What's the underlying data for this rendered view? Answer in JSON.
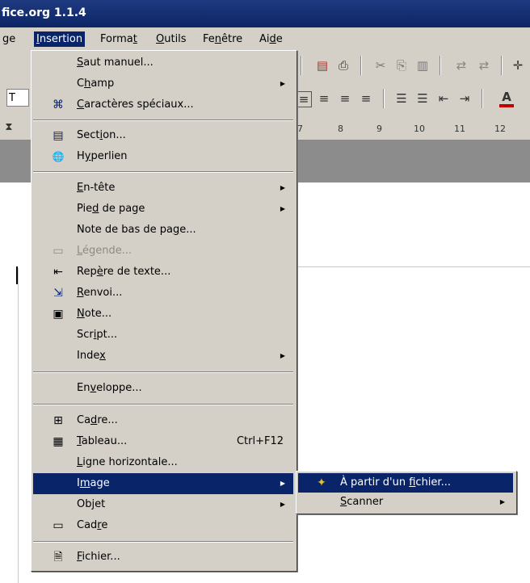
{
  "window": {
    "title_fragment": "fice.org 1.1.4"
  },
  "menubar": {
    "items": [
      {
        "label": "ge"
      },
      {
        "pre": "",
        "u": "I",
        "post": "nsertion"
      },
      {
        "pre": "Forma",
        "u": "t",
        "post": ""
      },
      {
        "pre": "",
        "u": "O",
        "post": "utils"
      },
      {
        "pre": "Fe",
        "u": "n",
        "post": "être"
      },
      {
        "pre": "Ai",
        "u": "d",
        "post": "e"
      }
    ]
  },
  "ruler": {
    "ticks": [
      "7",
      "8",
      "9",
      "10",
      "11",
      "12"
    ]
  },
  "toolbar": {
    "font_box_fragment": "T"
  },
  "insert_menu": {
    "items": [
      {
        "pre": "",
        "u": "S",
        "post": "aut manuel..."
      },
      {
        "pre": "C",
        "u": "h",
        "post": "amp",
        "arrow": "▶"
      },
      {
        "pre": "",
        "u": "C",
        "post": "aractères spéciaux...",
        "icon": "⌘"
      },
      {
        "pre": "Sect",
        "u": "i",
        "post": "on...",
        "icon": "▤"
      },
      {
        "pre": "H",
        "u": "y",
        "post": "perlien",
        "icon": "🌐"
      },
      {
        "pre": "",
        "u": "E",
        "post": "n-tête",
        "arrow": "▶"
      },
      {
        "pre": "Pie",
        "u": "d",
        "post": " de page",
        "arrow": "▶"
      },
      {
        "pre": "Note de bas de pa",
        "u": "g",
        "post": "e..."
      },
      {
        "pre": "",
        "u": "L",
        "post": "égende...",
        "icon": "▭"
      },
      {
        "pre": "Rep",
        "u": "è",
        "post": "re de texte...",
        "icon": "⇤"
      },
      {
        "pre": "",
        "u": "R",
        "post": "envoi...",
        "icon": "⇲"
      },
      {
        "pre": "",
        "u": "N",
        "post": "ote...",
        "icon": "▣"
      },
      {
        "pre": "Scr",
        "u": "i",
        "post": "pt..."
      },
      {
        "pre": "Inde",
        "u": "x",
        "post": "",
        "arrow": "▶"
      },
      {
        "pre": "En",
        "u": "v",
        "post": "eloppe..."
      },
      {
        "pre": "Ca",
        "u": "d",
        "post": "re...",
        "icon": "⊞"
      },
      {
        "pre": "",
        "u": "T",
        "post": "ableau...",
        "shortcut": "Ctrl+F12",
        "icon": "▦"
      },
      {
        "pre": "",
        "u": "L",
        "post": "igne horizontale..."
      },
      {
        "pre": "I",
        "u": "m",
        "post": "age",
        "arrow": "▶"
      },
      {
        "pre": "Ob",
        "u": "j",
        "post": "et",
        "arrow": "▶"
      },
      {
        "pre": "Cad",
        "u": "r",
        "post": "e",
        "icon": "▭"
      },
      {
        "pre": "",
        "u": "F",
        "post": "ichier...",
        "icon": "🗎"
      }
    ]
  },
  "image_submenu": {
    "items": [
      {
        "pre": "À partir d'un ",
        "u": "f",
        "post": "ichier...",
        "icon": "✦"
      },
      {
        "pre": "",
        "u": "S",
        "post": "canner",
        "arrow": "▶"
      }
    ]
  },
  "colors": {
    "highlight": "#0a246a",
    "menu_bg": "#d4d0c8",
    "disabled": "#8c8a84"
  }
}
